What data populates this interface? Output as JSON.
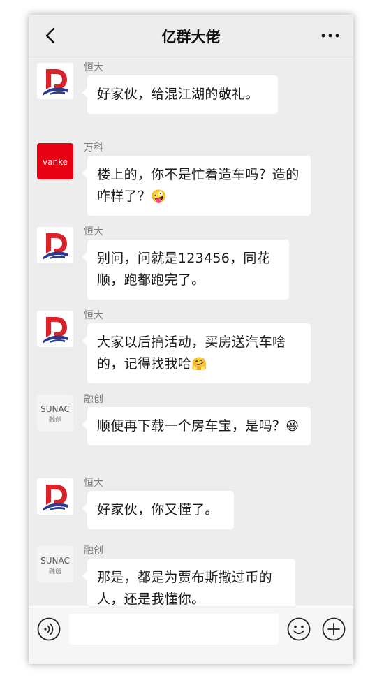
{
  "header": {
    "title": "亿群大佬"
  },
  "messages": [
    {
      "sender": "恒大",
      "text": "好家伙，给混江湖的敬礼。",
      "emoji": ""
    },
    {
      "sender": "万科",
      "text": "楼上的，你不是忙着造车吗？造的咋样了？",
      "emoji": "🤪"
    },
    {
      "sender": "恒大",
      "text": "别问，问就是123456，同花顺，跑都跑完了。",
      "emoji": ""
    },
    {
      "sender": "恒大",
      "text": "大家以后搞活动，买房送汽车啥的，记得找我哈",
      "emoji": "🤗"
    },
    {
      "sender": "融创",
      "text": "顺便再下载一个房车宝，是吗？",
      "emoji": "😆"
    },
    {
      "sender": "恒大",
      "text": "好家伙，你又懂了。",
      "emoji": ""
    },
    {
      "sender": "融创",
      "text": "那是，都是为贾布斯撒过币的人，还是我懂你。",
      "emoji": ""
    }
  ],
  "logos": {
    "vanke": "vanke",
    "sunac_en": "SUNAC",
    "sunac_cn": "融创"
  },
  "colors": {
    "evergrande_red": "#d8232a",
    "evergrande_blue": "#2a3c8f",
    "vanke_red": "#e60012",
    "sunac_orange": "#e8a33d"
  },
  "icons": {
    "back": "chevron-left-icon",
    "more": "more-dots-icon",
    "voice": "voice-icon",
    "emoji": "emoji-icon",
    "plus": "plus-icon"
  }
}
